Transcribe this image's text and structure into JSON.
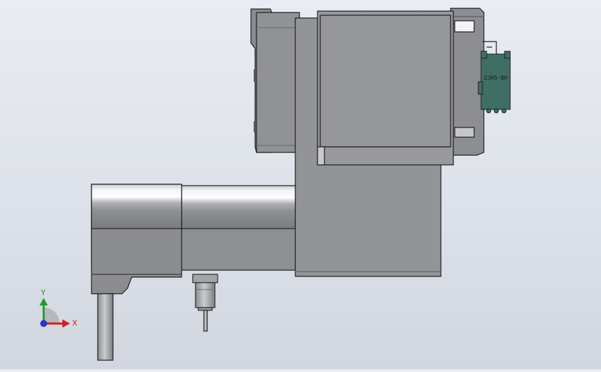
{
  "viewport": {
    "background_top": "#e9ecf2",
    "background_bottom": "#d2d6df"
  },
  "model": {
    "body_color": "#909193",
    "body_dark": "#7c7d80",
    "outline_color": "#1e1e20",
    "connector_color": "#3f6f64",
    "connector_label": "ZJH5-8H"
  },
  "triad": {
    "x_label": "X",
    "y_label": "Y",
    "x_color": "#d11f1f",
    "y_color": "#1f9d2b",
    "z_color": "#2538c9"
  }
}
